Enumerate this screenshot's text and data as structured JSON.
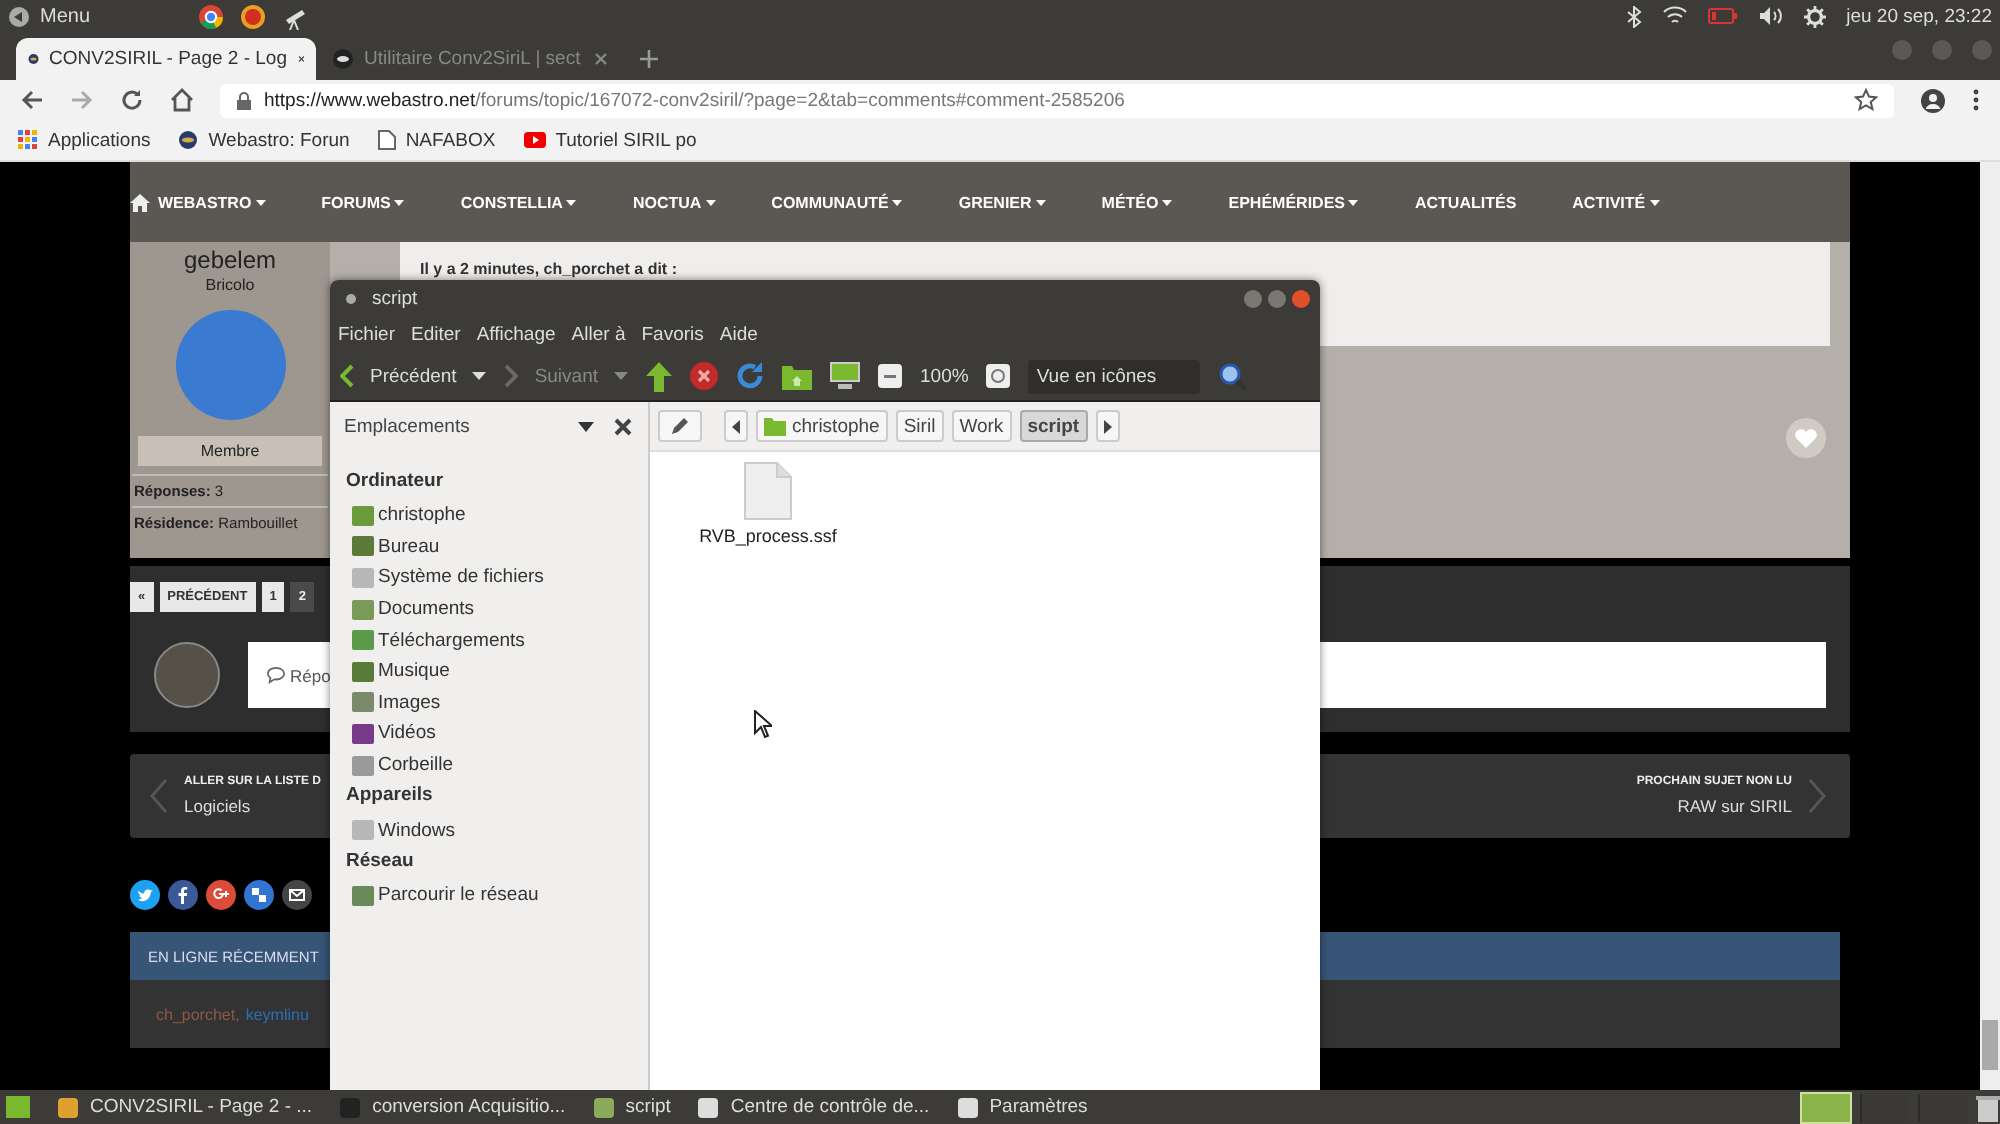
{
  "top_panel": {
    "menu": "Menu",
    "clock": "jeu 20 sep, 23:22"
  },
  "browser": {
    "tabs": [
      {
        "title": "CONV2SIRIL - Page 2 - Log",
        "selected": true
      },
      {
        "title": "Utilitaire Conv2SiriL | sect",
        "selected": false
      }
    ],
    "url": {
      "host": "https://www.webastro.net",
      "path": "/forums/topic/167072-conv2siril/?page=2&tab=comments#comment-2585206"
    },
    "bookmarks": [
      "Applications",
      "Webastro: Forun",
      "NAFABOX",
      "Tutoriel SIRIL po"
    ]
  },
  "site_nav": [
    {
      "label": "WEBASTRO",
      "dropdown": true
    },
    {
      "label": "FORUMS",
      "dropdown": true
    },
    {
      "label": "CONSTELLIA",
      "dropdown": true
    },
    {
      "label": "NOCTUA",
      "dropdown": true
    },
    {
      "label": "COMMUNAUTÉ",
      "dropdown": true
    },
    {
      "label": "GRENIER",
      "dropdown": true
    },
    {
      "label": "MÉTÉO",
      "dropdown": true
    },
    {
      "label": "EPHÉMÉRIDES",
      "dropdown": true
    },
    {
      "label": "ACTUALITÉS",
      "dropdown": false
    },
    {
      "label": "ACTIVITÉ",
      "dropdown": true
    }
  ],
  "post": {
    "author": "gebelem",
    "rank": "Bricolo",
    "group": "Membre",
    "stats": [
      {
        "label": "Réponses:",
        "value": "3"
      },
      {
        "label": "Résidence:",
        "value": "Rambouillet"
      }
    ],
    "quote_header": "Il y a 2 minutes, ch_porchet a dit :"
  },
  "pagination": [
    {
      "label": "«",
      "selected": false
    },
    {
      "label": "PRÉCÉDENT",
      "selected": false
    },
    {
      "label": "1",
      "selected": false
    },
    {
      "label": "2",
      "selected": true
    }
  ],
  "reply_placeholder": "Répo",
  "topic_nav": {
    "prev_label": "ALLER SUR LA LISTE D",
    "prev_title": "Logiciels",
    "next_label": "PROCHAIN SUJET NON LU",
    "next_title": "RAW sur SIRIL"
  },
  "online": {
    "title": "EN LIGNE RÉCEMMENT",
    "separator": ",",
    "users": [
      {
        "name": "ch_porchet",
        "color": "#8a5a44"
      },
      {
        "name": "keymlinu",
        "color": "#2b6fb5"
      }
    ]
  },
  "file_manager": {
    "title": "script",
    "menu": [
      "Fichier",
      "Editer",
      "Affichage",
      "Aller à",
      "Favoris",
      "Aide"
    ],
    "back": {
      "label": "Précédent",
      "disabled": false
    },
    "forward": {
      "label": "Suivant",
      "disabled": true
    },
    "zoom": "100%",
    "view": "Vue en icônes",
    "sidebar_title": "Emplacements",
    "path": [
      {
        "label": "christophe",
        "selected": false
      },
      {
        "label": "Siril",
        "selected": false
      },
      {
        "label": "Work",
        "selected": false
      },
      {
        "label": "script",
        "selected": true
      }
    ],
    "sections": [
      {
        "title": "Ordinateur",
        "items": [
          {
            "label": "christophe",
            "kind": "home"
          },
          {
            "label": "Bureau",
            "kind": "desktop"
          },
          {
            "label": "Système de fichiers",
            "kind": "drive"
          },
          {
            "label": "Documents",
            "kind": "documents"
          },
          {
            "label": "Téléchargements",
            "kind": "download"
          },
          {
            "label": "Musique",
            "kind": "music"
          },
          {
            "label": "Images",
            "kind": "pictures"
          },
          {
            "label": "Vidéos",
            "kind": "video"
          },
          {
            "label": "Corbeille",
            "kind": "trash"
          }
        ]
      },
      {
        "title": "Appareils",
        "items": [
          {
            "label": "Windows",
            "kind": "drive"
          }
        ]
      },
      {
        "title": "Réseau",
        "items": [
          {
            "label": "Parcourir le réseau",
            "kind": "network"
          }
        ]
      }
    ],
    "files": [
      "RVB_process.ssf"
    ]
  },
  "taskbar": [
    {
      "label": "CONV2SIRIL - Page 2 - ...",
      "kind": "browser"
    },
    {
      "label": "conversion Acquisitio...",
      "kind": "terminal"
    },
    {
      "label": "script",
      "kind": "folder"
    },
    {
      "label": "Centre de contrôle de...",
      "kind": "settings"
    },
    {
      "label": "Paramètres",
      "kind": "settings"
    }
  ]
}
